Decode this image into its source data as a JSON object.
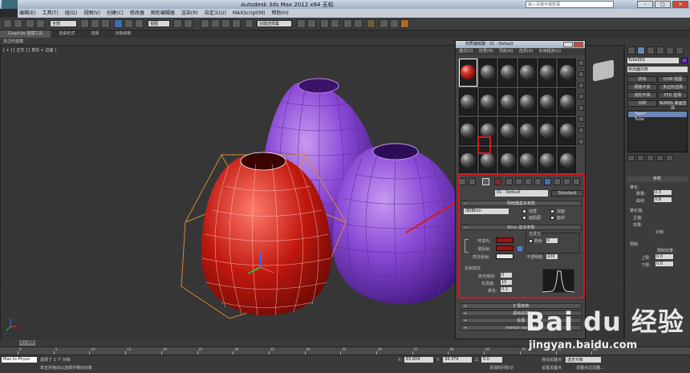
{
  "window": {
    "title": "Autodesk 3ds Max  2012 x64    无标",
    "search_placeholder": "输入关键字或短语",
    "buttons": [
      "–",
      "□",
      "×"
    ]
  },
  "menu": [
    "编辑(E)",
    "工具(T)",
    "组(G)",
    "视图(V)",
    "创建(C)",
    "修改器",
    "图形编辑器",
    "渲染(R)",
    "自定义(U)",
    "MAXScript(M)",
    "帮助(H)"
  ],
  "toolbar": {
    "selection_filter": "全部",
    "view_dropdown": "视图",
    "named_selection": "创建选择集"
  },
  "ribbon": {
    "tabs": [
      "Graphite 建模工具",
      "自由形式",
      "选择",
      "对象绘制"
    ],
    "active_tab": 0,
    "sub_label": "多边形建模"
  },
  "viewport": {
    "label": "[ + ] [ 正交 ] [ 真实 + 边面 ]"
  },
  "material_editor": {
    "title": "材质编辑器 - 01 - Default",
    "menu": [
      "模式(D)",
      "材质(M)",
      "导航(N)",
      "选项(O)",
      "实用程序(U)"
    ],
    "slot_count": 24,
    "active_slot": 0,
    "material_name": "01 - Default",
    "material_type": "Standard",
    "rollouts": {
      "shader_basic": "明暗器基本参数",
      "blinn_basic": "Blinn 基本参数",
      "extended": "扩展参数",
      "supersampling": "超级采样",
      "maps": "贴图",
      "mental_ray": "mental ray 连接"
    },
    "shader": {
      "type": "(B)Blinn",
      "wire": "线框",
      "two_sided": "双面",
      "face_map": "面贴图",
      "faceted": "面状"
    },
    "blinn": {
      "ambient": "环境光:",
      "diffuse": "漫反射:",
      "specular": "高光反射:",
      "self_illum": "自发光",
      "color": "颜色",
      "color_value": "0",
      "opacity": "不透明度:",
      "opacity_value": "100",
      "specular_highlights": "反射高光",
      "spec_level": "高光级别:",
      "spec_level_value": "0",
      "glossiness": "光泽度:",
      "glossiness_value": "10",
      "soften": "柔化:",
      "soften_value": "0.1",
      "ambient_color": "#a30f0f",
      "diffuse_color": "#a30f0f",
      "specular_color": "#e6e6e6"
    }
  },
  "command_panel": {
    "object_name": "Tube001",
    "modifier_list": "修改器列表",
    "buttons": [
      "挤出",
      "UVW 贴图",
      "网格平滑",
      "多边形选择",
      "涡轮平滑",
      "FFD 选择",
      "对称",
      "NURBS 曲面选择"
    ],
    "stack": [
      "Taper",
      "Tube"
    ],
    "selected_stack": 0,
    "parameters_title": "参数",
    "taper": {
      "taper_label": "锥化:",
      "amount_label": "数量:",
      "amount_value": "0.3",
      "curve_label": "曲线:",
      "curve_value": "0.8",
      "axis_label": "锥化轴:",
      "primary_label": "主轴:",
      "effect_label": "效果:",
      "symmetry_label": "对称",
      "limit_label": "限制",
      "limit_effect": "限制效果",
      "upper_label": "上限:",
      "upper_value": "0.0",
      "lower_label": "下限:",
      "lower_value": "0.0"
    }
  },
  "timeline": {
    "position": "0 / 100",
    "ticks": [
      "0",
      "5",
      "10",
      "15",
      "20",
      "25",
      "30",
      "35",
      "40",
      "45",
      "50",
      "55",
      "60",
      "65",
      "70",
      "75",
      "80"
    ]
  },
  "status": {
    "maxscript": "Max to Physx",
    "line1": "选择了 1 个 对象",
    "line2": "单击并拖动以选择并移动对象",
    "x_label": "X:",
    "x_value": "83.809",
    "y_label": "Y:",
    "y_value": "34.379",
    "z_label": "Z:",
    "z_value": "0.0",
    "add_time_tag": "添加时间标记",
    "auto_key": "自动关键点",
    "set_key": "设置关键点",
    "selected": "选定对象",
    "key_filters": "关键点过滤器..."
  },
  "watermark": {
    "brand": "Bai du 经验",
    "url": "jingyan.baidu.com"
  }
}
